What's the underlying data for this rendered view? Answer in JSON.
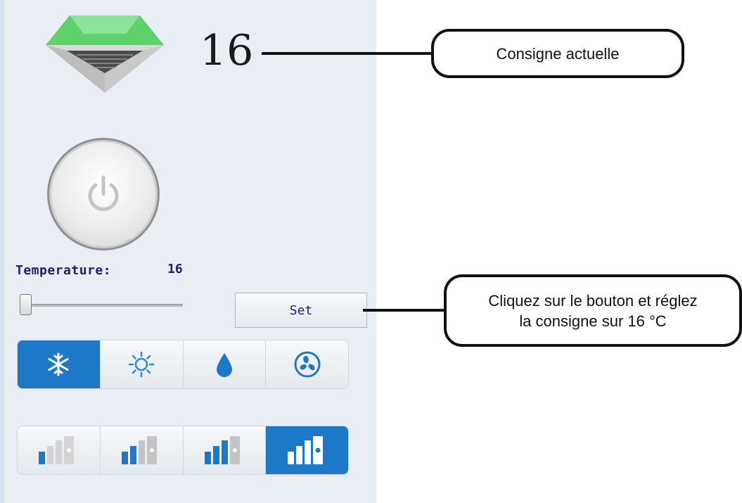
{
  "display": {
    "current_setpoint": "16"
  },
  "controls": {
    "temperature_label": "Temperature:",
    "temperature_value": "16",
    "slider_value": 16,
    "set_label": "Set"
  },
  "modes": {
    "items": [
      "snowflake-icon",
      "sun-icon",
      "water-drop-icon",
      "fan-icon"
    ],
    "active_index": 0
  },
  "fan_speeds": {
    "items": [
      "fan-speed-1-icon",
      "fan-speed-2-icon",
      "fan-speed-3-icon",
      "fan-speed-auto-icon"
    ],
    "active_index": 3
  },
  "colors": {
    "accent": "#1e78c8",
    "unit_green": "#4cbf4a",
    "label_text": "#20206e"
  },
  "callouts": {
    "setpoint_note": "Consigne actuelle",
    "set_note_line1": "Cliquez sur le bouton et réglez",
    "set_note_line2": "la consigne sur 16 °C"
  }
}
